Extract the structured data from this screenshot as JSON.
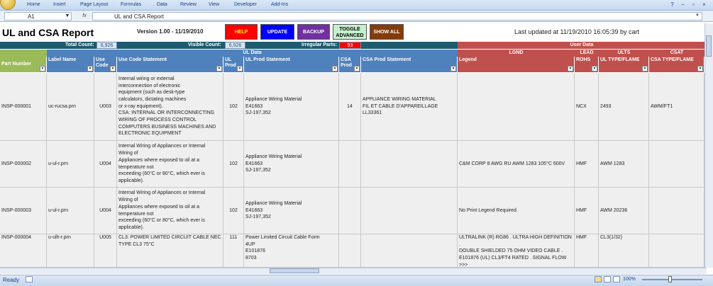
{
  "ribbon": {
    "tabs": [
      "Home",
      "Insert",
      "Page Layout",
      "Formulas",
      "Data",
      "Review",
      "View",
      "Developer",
      "Add-Ins"
    ]
  },
  "formula_bar": {
    "cell_ref": "A1",
    "fx": "fx",
    "value": "UL and CSA Report"
  },
  "report": {
    "title": "UL and CSA Report",
    "version": "Version 1.00 - 11/19/2010",
    "last_updated": "Last updated at 11/19/2010 16:05:39 by cart"
  },
  "buttons": {
    "help": "HELP",
    "update": "UPDATE",
    "backup": "BACKUP",
    "toggle": "TOGGLE\nADVANCED",
    "show_all": "SHOW ALL"
  },
  "colors": {
    "help": "#ff0000",
    "update": "#0000ff",
    "backup": "#7030a0",
    "toggle": "#c6efce",
    "show_all": "#833c0b",
    "teal": "#1f5b6e",
    "blue": "#4f81bd",
    "red": "#c0504d",
    "green": "#9bbb59"
  },
  "counts": {
    "total_label": "Total Count:",
    "total_value": "6,926",
    "visible_label": "Visible Count:",
    "visible_value": "6,926",
    "irregular_label": "Irregular Parts:",
    "irregular_value": "93"
  },
  "groups": {
    "ul_data": "UL Data",
    "user_data": "User Data",
    "lgnd": "LGND",
    "lead": "LEAD",
    "ults": "ULTS",
    "csat": "CSAT"
  },
  "columns": [
    "Part Number",
    "Label Name",
    "Use Code",
    "Use Code Statement",
    "UL Prod",
    "UL Prod Statement",
    "CSA Prod",
    "CSA Prod Statement",
    "Legend",
    "ROHS",
    "UL TYPE/FLAME",
    "CSA TYPE/FLAME"
  ],
  "rows": [
    {
      "part": "INSP-000001",
      "label": "uc-rucsa.prn",
      "use_code": "U003",
      "use_stmt": "Internal wiring or external\ninterconnection of electronic\nequipment (such as desk-type\ncalculators, dictating machines\nor x-ray equipment).\nCSA: INTERNAL OR INTERCONNECTING\nWIRING OF PROCESS CONTROL\nCOMPUTERS BUSINESS MACHINES AND\nELECTRONIC EQUIPMENT",
      "ul_prod": "102",
      "ul_stmt": "Appliance Wiring Material\nE41663\nSJ-197,352",
      "csa_prod": "14",
      "csa_stmt": "APPLIANCE WIRING MATERIAL\nFIL ET CABLE D'APPAREILLAGE\nLL33361",
      "legend": "",
      "rohs": "NCX",
      "ul_type": "2493",
      "csa_type": "AWM/FT1"
    },
    {
      "part": "INSP-000002",
      "label": "u-ul-r.prn",
      "use_code": "U004",
      "use_stmt": "Internal Wiring of Appliances or Internal\nWiring of\nAppliances where exposed to oil at a\ntemperature not\nexceeding (60°C or 80°C, which ever is\napplicable).",
      "ul_prod": "102",
      "ul_stmt": "Appliance Wiring Material\nE41663\nSJ-197,352",
      "csa_prod": "",
      "csa_stmt": "",
      "legend": "C&M CORP 8 AWG RU AWM 1283 105°C 600V",
      "rohs": "HMF",
      "ul_type": "AWM 1283",
      "csa_type": ""
    },
    {
      "part": "INSP-000003",
      "label": "u-ul-r.prn",
      "use_code": "U004",
      "use_stmt": "Internal Wiring of Appliances or Internal\nWiring of\nAppliances where exposed to oil at a\ntemperature not\nexceeding (60°C or 80°C, which ever is\napplicable).",
      "ul_prod": "102",
      "ul_stmt": "Appliance Wiring Material\nE41663\nSJ-197,352",
      "csa_prod": "",
      "csa_stmt": "",
      "legend": "No Print Legend Required.",
      "rohs": "HMF",
      "ul_type": "AWM 20236",
      "csa_type": ""
    },
    {
      "part": "INSP-000004",
      "label": "u-ulh-r.prn",
      "use_code": "U005",
      "use_stmt": "CL3:  POWER LIMITED CIRCUIT CABLE NEC\nTYPE CL3 75°C",
      "ul_prod": "111",
      "ul_stmt": "Power Limited Circuit Cable Form\n4UP\nE101876\n8703",
      "csa_prod": "",
      "csa_stmt": "",
      "legend": "ULTRALINK (R) RG86 . ULTRA HIGH DEFINITION .\nDOUBLE SHIELDED 75 OHM VIDEO CABLE .\nE101876 (UL) CL3/FT4 RATED . SIGNAL FLOW\n>>>",
      "rohs": "HMF",
      "ul_type": "CL3(1/32)",
      "csa_type": ""
    }
  ],
  "status": {
    "ready": "Ready",
    "zoom": "100%"
  }
}
